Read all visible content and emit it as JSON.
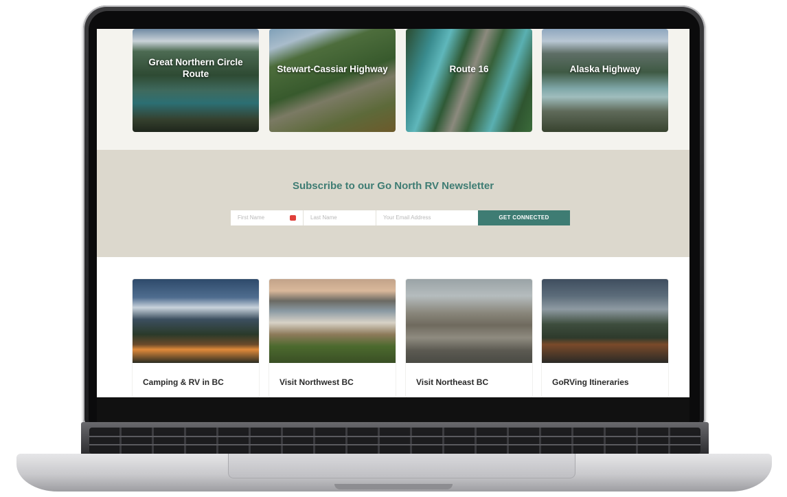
{
  "routes": [
    {
      "label": "Great Northern Circle Route"
    },
    {
      "label": "Stewart-Cassiar Highway"
    },
    {
      "label": "Route 16"
    },
    {
      "label": "Alaska Highway"
    }
  ],
  "newsletter": {
    "title": "Subscribe to our Go North RV Newsletter",
    "first_name_placeholder": "First Name",
    "last_name_placeholder": "Last Name",
    "email_placeholder": "Your Email Address",
    "button_label": "GET CONNECTED"
  },
  "cards": [
    {
      "title": "Camping & RV in BC"
    },
    {
      "title": "Visit Northwest BC"
    },
    {
      "title": "Visit Northeast BC"
    },
    {
      "title": "GoRVing Itineraries"
    }
  ],
  "colors": {
    "accent": "#3e7c73",
    "newsletter_bg": "#dcd8cd",
    "page_bg": "#f4f3ee"
  }
}
